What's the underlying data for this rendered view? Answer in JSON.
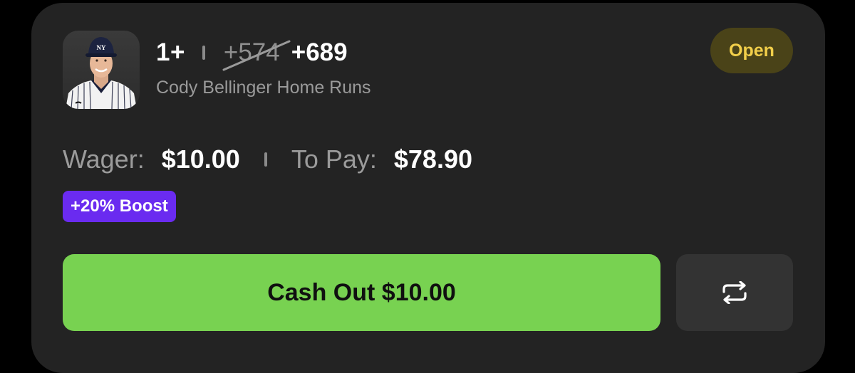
{
  "bet": {
    "line": "1+",
    "original_odds": "+574",
    "boosted_odds": "+689",
    "market": "Cody Bellinger Home Runs",
    "status": "Open"
  },
  "player": {
    "name": "Cody Bellinger",
    "avatar_icon": "player-headshot"
  },
  "wager": {
    "wager_label": "Wager:",
    "wager_value": "$10.00",
    "to_pay_label": "To Pay:",
    "to_pay_value": "$78.90"
  },
  "boost": {
    "label": "+20% Boost"
  },
  "actions": {
    "cashout_label": "Cash Out $10.00",
    "repeat_icon": "repeat-icon"
  },
  "colors": {
    "card_bg": "#232323",
    "status_text": "#f2cf4a",
    "status_bg": "#4a4318",
    "boost_bg": "#6a2bf0",
    "cashout_bg": "#78d251"
  }
}
